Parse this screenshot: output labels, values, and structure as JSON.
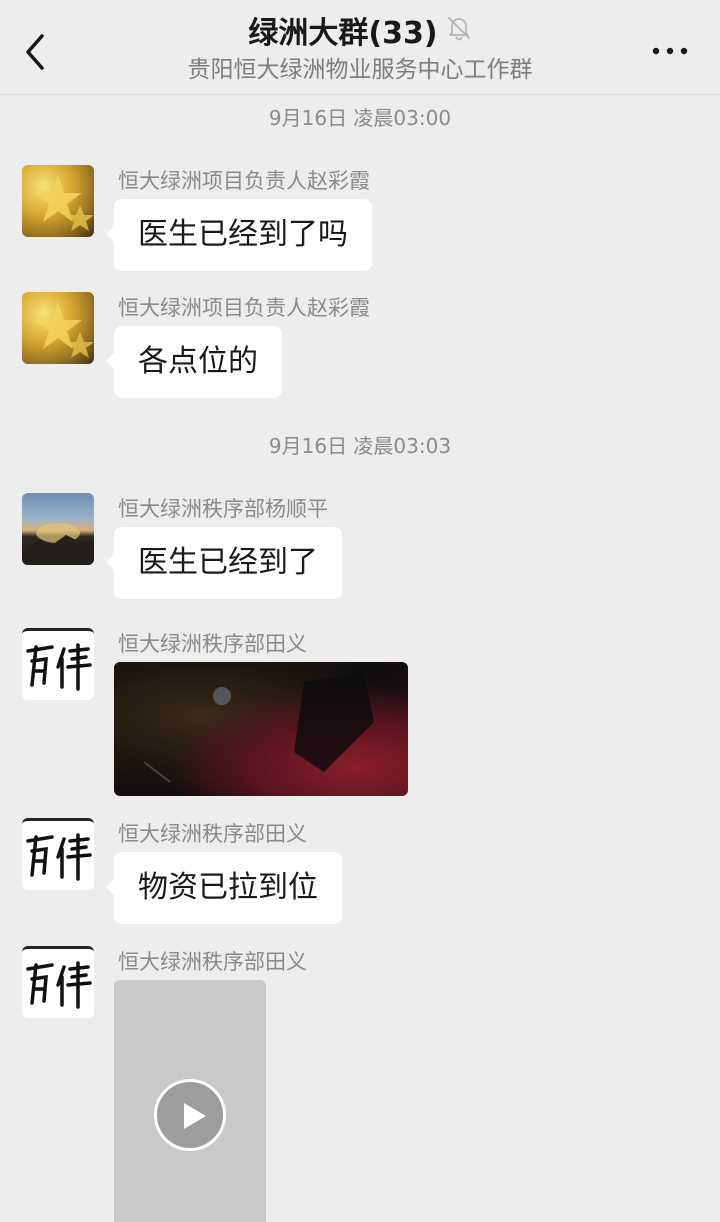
{
  "header": {
    "title": "绿洲大群(33)",
    "subtitle": "贵阳恒大绿洲物业服务中心工作群",
    "back_icon": "chevron-left-icon",
    "mute_icon": "bell-off-icon",
    "more_icon": "more-horizontal-icon"
  },
  "timestamps": [
    "9月16日 凌晨03:00",
    "9月16日 凌晨03:03"
  ],
  "messages": [
    {
      "sender": "恒大绿洲项目负责人赵彩霞",
      "type": "text",
      "text": "医生已经到了吗",
      "avatar": "star-fruit-avatar"
    },
    {
      "sender": "恒大绿洲项目负责人赵彩霞",
      "type": "text",
      "text": "各点位的",
      "avatar": "star-fruit-avatar"
    },
    {
      "sender": "恒大绿洲秩序部杨顺平",
      "type": "text",
      "text": "医生已经到了",
      "avatar": "mountain-avatar"
    },
    {
      "sender": "恒大绿洲秩序部田义",
      "type": "image",
      "avatar": "calligraphy-avatar"
    },
    {
      "sender": "恒大绿洲秩序部田义",
      "type": "text",
      "text": "物资已拉到位",
      "avatar": "calligraphy-avatar"
    },
    {
      "sender": "恒大绿洲秩序部田义",
      "type": "video",
      "avatar": "calligraphy-avatar"
    }
  ],
  "colors": {
    "background": "#ededed",
    "bubble": "#ffffff",
    "text": "#191919",
    "meta": "#8a8a8a"
  }
}
